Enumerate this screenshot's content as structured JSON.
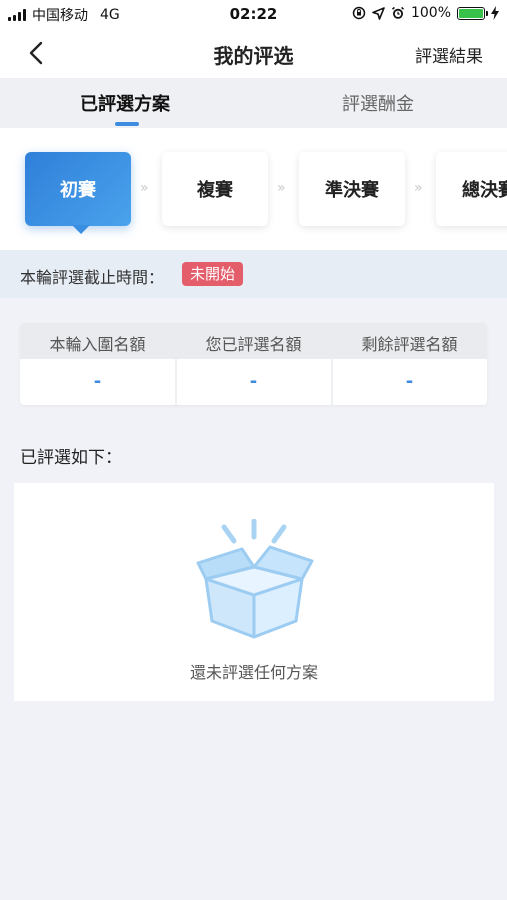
{
  "status_bar": {
    "carrier": "中国移动",
    "network": "4G",
    "time": "02:22",
    "battery": "100%"
  },
  "nav": {
    "title": "我的评选",
    "action_label": "評選結果",
    "back_icon": "chevron-left-icon"
  },
  "tabs": [
    {
      "label": "已評選方案",
      "active": true
    },
    {
      "label": "評選酬金",
      "active": false
    }
  ],
  "stages": [
    {
      "label": "初賽",
      "active": true
    },
    {
      "label": "複賽",
      "active": false
    },
    {
      "label": "準決賽",
      "active": false
    },
    {
      "label": "總決賽",
      "active": false
    }
  ],
  "stage_separator": "»",
  "deadline": {
    "label": "本輪評選截止時間：",
    "status": "未開始"
  },
  "quota": {
    "headers": [
      "本輪入圍名額",
      "您已評選名額",
      "剩餘評選名額"
    ],
    "values": [
      "-",
      "-",
      "-"
    ]
  },
  "selected": {
    "title": "已評選如下：",
    "empty_text": "還未評選任何方案",
    "empty_icon": "open-box-icon"
  },
  "colors": {
    "accent": "#3d8ce0",
    "badge": "#e35d6a",
    "battery": "#38c24a"
  }
}
